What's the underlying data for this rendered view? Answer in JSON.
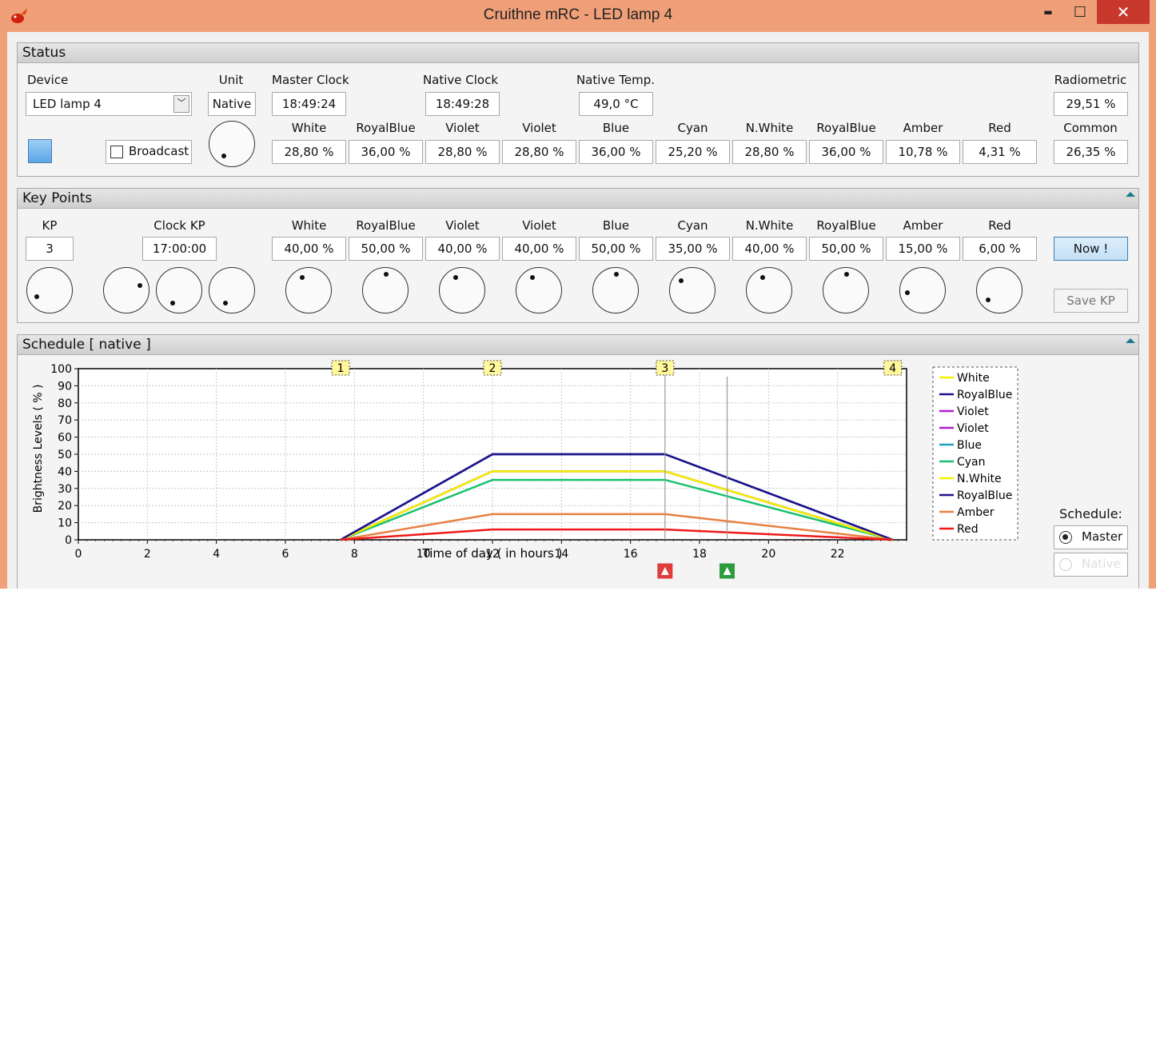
{
  "window": {
    "title": "Cruithne mRC   -   LED lamp 4",
    "minimize_label": "▬",
    "maximize_label": "☐",
    "close_label": "✕"
  },
  "status": {
    "title": "Status",
    "device_label": "Device",
    "device_value": "LED lamp 4",
    "unit_label": "Unit",
    "unit_value": "Native",
    "master_clock_label": "Master Clock",
    "master_clock_value": "18:49:24",
    "native_clock_label": "Native  Clock",
    "native_clock_value": "18:49:28",
    "native_temp_label": "Native  Temp.",
    "native_temp_value": "49,0 °C",
    "radiometric_label": "Radiometric",
    "radiometric_value": "29,51 %",
    "common_label": "Common",
    "common_value": "26,35 %",
    "broadcast_label": "Broadcast",
    "channels": [
      {
        "name": "White",
        "value": "28,80 %"
      },
      {
        "name": "RoyalBlue",
        "value": "36,00 %"
      },
      {
        "name": "Violet",
        "value": "28,80 %"
      },
      {
        "name": "Violet",
        "value": "28,80 %"
      },
      {
        "name": "Blue",
        "value": "36,00 %"
      },
      {
        "name": "Cyan",
        "value": "25,20 %"
      },
      {
        "name": "N.White",
        "value": "28,80 %"
      },
      {
        "name": "RoyalBlue",
        "value": "36,00 %"
      },
      {
        "name": "Amber",
        "value": "10,78 %"
      },
      {
        "name": "Red",
        "value": "4,31 %"
      }
    ]
  },
  "keypoints": {
    "title": "Key Points",
    "kp_label": "KP",
    "kp_value": "3",
    "clock_kp_label": "Clock  KP",
    "clock_kp_value": "17:00:00",
    "now_button": "Now !",
    "save_button": "Save  KP",
    "channels": [
      {
        "name": "White",
        "value": "40,00 %"
      },
      {
        "name": "RoyalBlue",
        "value": "50,00 %"
      },
      {
        "name": "Violet",
        "value": "40,00 %"
      },
      {
        "name": "Violet",
        "value": "40,00 %"
      },
      {
        "name": "Blue",
        "value": "50,00 %"
      },
      {
        "name": "Cyan",
        "value": "35,00 %"
      },
      {
        "name": "N.White",
        "value": "40,00 %"
      },
      {
        "name": "RoyalBlue",
        "value": "50,00 %"
      },
      {
        "name": "Amber",
        "value": "15,00 %"
      },
      {
        "name": "Red",
        "value": "6,00 %"
      }
    ]
  },
  "schedule": {
    "title": "Schedule  [ native ]",
    "schedule_label": "Schedule:",
    "master_option": "Master",
    "native_option": "Native"
  },
  "colors": {
    "accent_button": "#cde4f7",
    "title_bar": "#f0a079",
    "close_button": "#c7372c",
    "marker_red": "#e03c3c",
    "marker_green": "#2e9a3e"
  },
  "chart_data": {
    "type": "line",
    "xlabel": "Time of day  ( in hours )",
    "ylabel": "Brightness Levels  ( % )",
    "xlim": [
      0,
      24
    ],
    "ylim": [
      0,
      100
    ],
    "xticks": [
      0,
      2,
      4,
      6,
      8,
      10,
      12,
      14,
      16,
      18,
      20,
      22
    ],
    "yticks": [
      0,
      10,
      20,
      30,
      40,
      50,
      60,
      70,
      80,
      90,
      100
    ],
    "grid": true,
    "legend_position": "right",
    "key_points": [
      {
        "label": "1",
        "x": 7.6
      },
      {
        "label": "2",
        "x": 12
      },
      {
        "label": "3",
        "x": 17
      },
      {
        "label": "4",
        "x": 23.6
      }
    ],
    "x": [
      7.6,
      12,
      17,
      23.6
    ],
    "series": [
      {
        "name": "White",
        "color": "#f2f200",
        "values": [
          0,
          40,
          40,
          0
        ]
      },
      {
        "name": "RoyalBlue",
        "color": "#20108a",
        "values": [
          0,
          50,
          50,
          0
        ]
      },
      {
        "name": "Violet",
        "color": "#b020d0",
        "values": [
          0,
          40,
          40,
          0
        ]
      },
      {
        "name": "Violet",
        "color": "#b020d0",
        "values": [
          0,
          40,
          40,
          0
        ]
      },
      {
        "name": "Blue",
        "color": "#1aa0c0",
        "values": [
          0,
          50,
          50,
          0
        ]
      },
      {
        "name": "Cyan",
        "color": "#18c070",
        "values": [
          0,
          35,
          35,
          0
        ]
      },
      {
        "name": "N.White",
        "color": "#f2f200",
        "values": [
          0,
          40,
          40,
          0
        ]
      },
      {
        "name": "RoyalBlue",
        "color": "#20108a",
        "values": [
          0,
          50,
          50,
          0
        ]
      },
      {
        "name": "Amber",
        "color": "#e88040",
        "values": [
          0,
          15,
          15,
          0
        ]
      },
      {
        "name": "Red",
        "color": "#f01818",
        "values": [
          0,
          6,
          6,
          0
        ]
      }
    ],
    "time_markers": [
      {
        "x": 17,
        "color": "#e03c3c"
      },
      {
        "x": 18.8,
        "color": "#2e9a3e"
      }
    ]
  }
}
